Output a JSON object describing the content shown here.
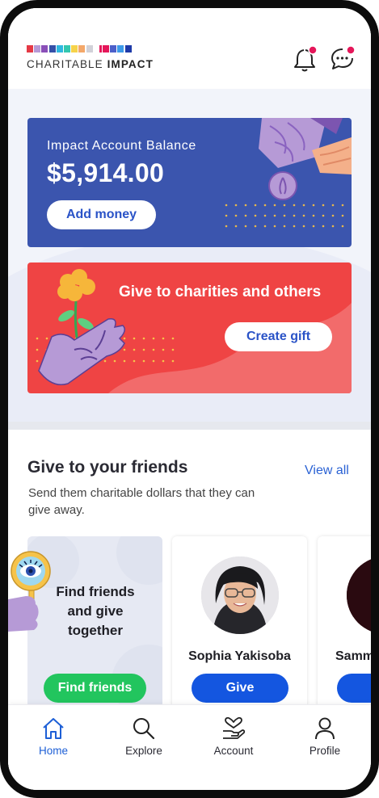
{
  "header": {
    "logo_text_light": "CHARITABLE ",
    "logo_text_bold": "IMPACT",
    "logo_colors": [
      "#e53945",
      "#b69ad6",
      "#8a4fb8",
      "#3550a8",
      "#2fb8e0",
      "#33c7b0",
      "#f6d34a",
      "#f4a86a",
      "#d1d1d8",
      "#e5175a",
      "#4c5fc9",
      "#3d9be9",
      "#1e3aa8"
    ]
  },
  "balance_card": {
    "label": "Impact Account Balance",
    "amount": "$5,914.00",
    "add_money_label": "Add money"
  },
  "gift_card": {
    "headline": "Give to charities and others",
    "create_gift_label": "Create gift"
  },
  "friends": {
    "title": "Give to your friends",
    "view_all": "View all",
    "subtitle": "Send them charitable dollars that they can give away.",
    "find_card": {
      "text": "Find friends and give together",
      "button": "Find friends"
    },
    "people": [
      {
        "name": "Sophia Yakisoba",
        "button": "Give"
      },
      {
        "name": "Samm"
      }
    ]
  },
  "nav": {
    "items": [
      {
        "label": "Home",
        "active": true
      },
      {
        "label": "Explore"
      },
      {
        "label": "Account"
      },
      {
        "label": "Profile"
      }
    ]
  },
  "colors": {
    "brand_blue": "#3b55ae",
    "gift_red": "#ef4444",
    "primary_button": "#1456e0",
    "green_button": "#22c55e",
    "link": "#2a62d4",
    "notification_dot": "#e5175a"
  }
}
